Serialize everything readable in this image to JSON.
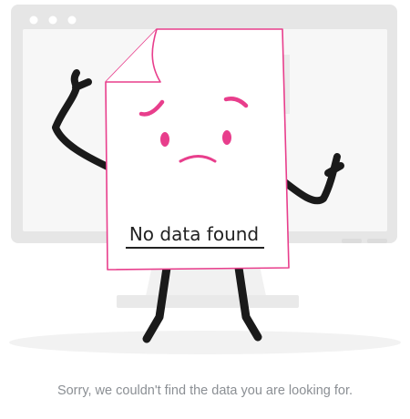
{
  "empty_state": {
    "paper_label": "No data found",
    "message": "Sorry, we couldn't find the data you are looking for."
  },
  "colors": {
    "accent": "#e83e8c",
    "ink": "#1a1a1a",
    "monitor_frame": "#e6e6e6",
    "monitor_screen": "#f7f7f7",
    "message_text": "#8b8f94"
  },
  "icons": {
    "illustration": "sad-document-character-icon"
  }
}
